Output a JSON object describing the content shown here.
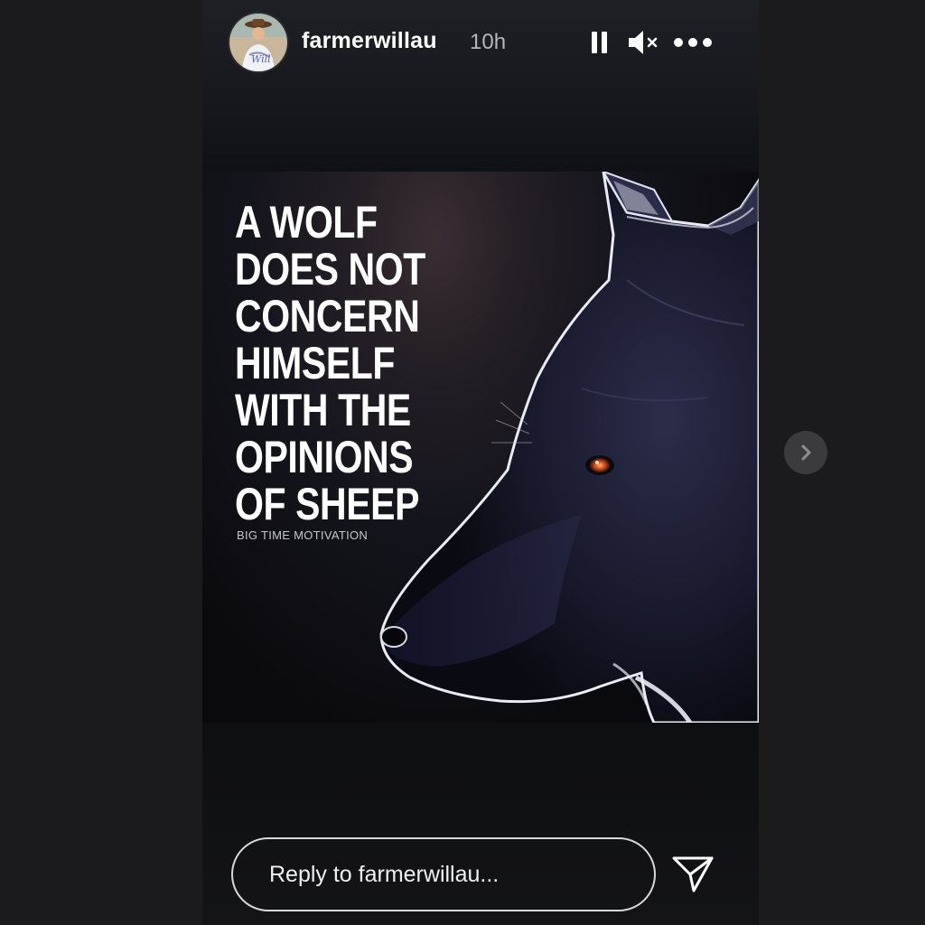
{
  "story": {
    "username": "farmerwillau",
    "time": "10h",
    "avatar_caption": "Will"
  },
  "controls": {
    "pause_icon": "pause-icon",
    "mute_icon": "speaker-muted-icon",
    "more_icon": "more-dots-icon"
  },
  "post": {
    "quote": "A WOLF\nDOES NOT\nCONCERN\nHIMSELF\nWITH THE\nOPINIONS\nOF SHEEP",
    "credit": "BIG TIME MOTIVATION"
  },
  "reply": {
    "placeholder": "Reply to farmerwillau...",
    "send_icon": "send-icon"
  },
  "navigation": {
    "next_icon": "chevron-right-icon"
  },
  "colors": {
    "background": "#1b1b1d",
    "story_bg": "#101117",
    "text": "#ffffff",
    "muted_text": "#b7b7ba",
    "wolf_eye": "#e0541c"
  }
}
